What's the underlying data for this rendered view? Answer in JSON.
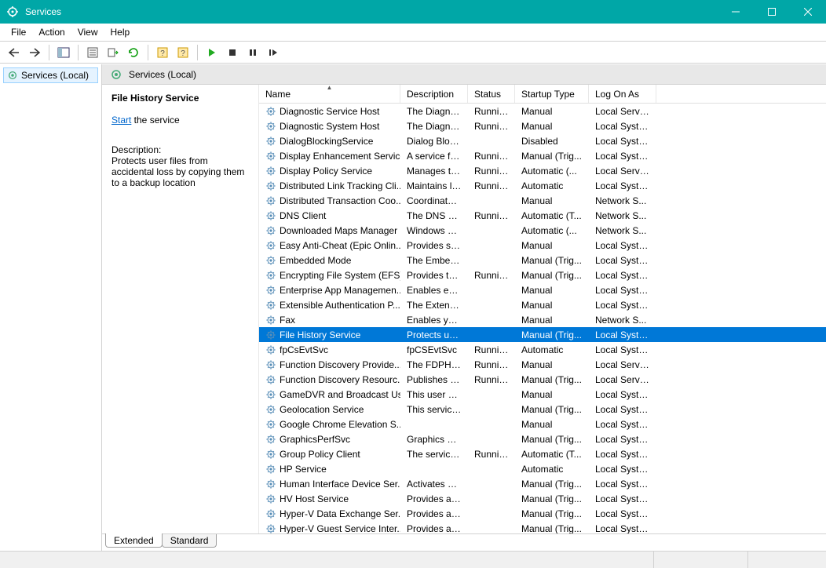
{
  "window": {
    "title": "Services",
    "minimize": "Minimize",
    "maximize": "Maximize",
    "close": "Close"
  },
  "menu": {
    "items": [
      "File",
      "Action",
      "View",
      "Help"
    ]
  },
  "tree": {
    "root": "Services (Local)"
  },
  "content_header": "Services (Local)",
  "detail": {
    "title": "File History Service",
    "start_label": "Start",
    "start_suffix": " the service",
    "desc_label": "Description:",
    "desc_text": "Protects user files from accidental loss by copying them to a backup location"
  },
  "columns": {
    "name": "Name",
    "description": "Description",
    "status": "Status",
    "startup": "Startup Type",
    "logon": "Log On As"
  },
  "tabs": {
    "extended": "Extended",
    "standard": "Standard"
  },
  "services": [
    {
      "name": "Diagnostic Service Host",
      "description": "The Diagno...",
      "status": "Running",
      "startup": "Manual",
      "logon": "Local Service"
    },
    {
      "name": "Diagnostic System Host",
      "description": "The Diagno...",
      "status": "Running",
      "startup": "Manual",
      "logon": "Local Syste..."
    },
    {
      "name": "DialogBlockingService",
      "description": "Dialog Bloc...",
      "status": "",
      "startup": "Disabled",
      "logon": "Local Syste..."
    },
    {
      "name": "Display Enhancement Service",
      "description": "A service fo...",
      "status": "Running",
      "startup": "Manual (Trig...",
      "logon": "Local Syste..."
    },
    {
      "name": "Display Policy Service",
      "description": "Manages th...",
      "status": "Running",
      "startup": "Automatic (...",
      "logon": "Local Service"
    },
    {
      "name": "Distributed Link Tracking Cli...",
      "description": "Maintains li...",
      "status": "Running",
      "startup": "Automatic",
      "logon": "Local Syste..."
    },
    {
      "name": "Distributed Transaction Coo...",
      "description": "Coordinates...",
      "status": "",
      "startup": "Manual",
      "logon": "Network S..."
    },
    {
      "name": "DNS Client",
      "description": "The DNS Cli...",
      "status": "Running",
      "startup": "Automatic (T...",
      "logon": "Network S..."
    },
    {
      "name": "Downloaded Maps Manager",
      "description": "Windows se...",
      "status": "",
      "startup": "Automatic (...",
      "logon": "Network S..."
    },
    {
      "name": "Easy Anti-Cheat (Epic Onlin...",
      "description": "Provides se...",
      "status": "",
      "startup": "Manual",
      "logon": "Local Syste..."
    },
    {
      "name": "Embedded Mode",
      "description": "The Embed...",
      "status": "",
      "startup": "Manual (Trig...",
      "logon": "Local Syste..."
    },
    {
      "name": "Encrypting File System (EFS)",
      "description": "Provides th...",
      "status": "Running",
      "startup": "Manual (Trig...",
      "logon": "Local Syste..."
    },
    {
      "name": "Enterprise App Managemen...",
      "description": "Enables ent...",
      "status": "",
      "startup": "Manual",
      "logon": "Local Syste..."
    },
    {
      "name": "Extensible Authentication P...",
      "description": "The Extensi...",
      "status": "",
      "startup": "Manual",
      "logon": "Local Syste..."
    },
    {
      "name": "Fax",
      "description": "Enables you...",
      "status": "",
      "startup": "Manual",
      "logon": "Network S..."
    },
    {
      "name": "File History Service",
      "description": "Protects use...",
      "status": "",
      "startup": "Manual (Trig...",
      "logon": "Local Syste...",
      "selected": true
    },
    {
      "name": "fpCsEvtSvc",
      "description": "fpCSEvtSvc",
      "status": "Running",
      "startup": "Automatic",
      "logon": "Local Syste..."
    },
    {
      "name": "Function Discovery Provide...",
      "description": "The FDPHO...",
      "status": "Running",
      "startup": "Manual",
      "logon": "Local Service"
    },
    {
      "name": "Function Discovery Resourc...",
      "description": "Publishes th...",
      "status": "Running",
      "startup": "Manual (Trig...",
      "logon": "Local Service"
    },
    {
      "name": "GameDVR and Broadcast Us...",
      "description": "This user ser...",
      "status": "",
      "startup": "Manual",
      "logon": "Local Syste..."
    },
    {
      "name": "Geolocation Service",
      "description": "This service ...",
      "status": "",
      "startup": "Manual (Trig...",
      "logon": "Local Syste..."
    },
    {
      "name": "Google Chrome Elevation S...",
      "description": "",
      "status": "",
      "startup": "Manual",
      "logon": "Local Syste..."
    },
    {
      "name": "GraphicsPerfSvc",
      "description": "Graphics pe...",
      "status": "",
      "startup": "Manual (Trig...",
      "logon": "Local Syste..."
    },
    {
      "name": "Group Policy Client",
      "description": "The service i...",
      "status": "Running",
      "startup": "Automatic (T...",
      "logon": "Local Syste..."
    },
    {
      "name": "HP Service",
      "description": "",
      "status": "",
      "startup": "Automatic",
      "logon": "Local Syste..."
    },
    {
      "name": "Human Interface Device Ser...",
      "description": "Activates an...",
      "status": "",
      "startup": "Manual (Trig...",
      "logon": "Local Syste..."
    },
    {
      "name": "HV Host Service",
      "description": "Provides an...",
      "status": "",
      "startup": "Manual (Trig...",
      "logon": "Local Syste..."
    },
    {
      "name": "Hyper-V Data Exchange Ser...",
      "description": "Provides a ...",
      "status": "",
      "startup": "Manual (Trig...",
      "logon": "Local Syste..."
    },
    {
      "name": "Hyper-V Guest Service Inter...",
      "description": "Provides an ...",
      "status": "",
      "startup": "Manual (Trig...",
      "logon": "Local Syste..."
    }
  ]
}
